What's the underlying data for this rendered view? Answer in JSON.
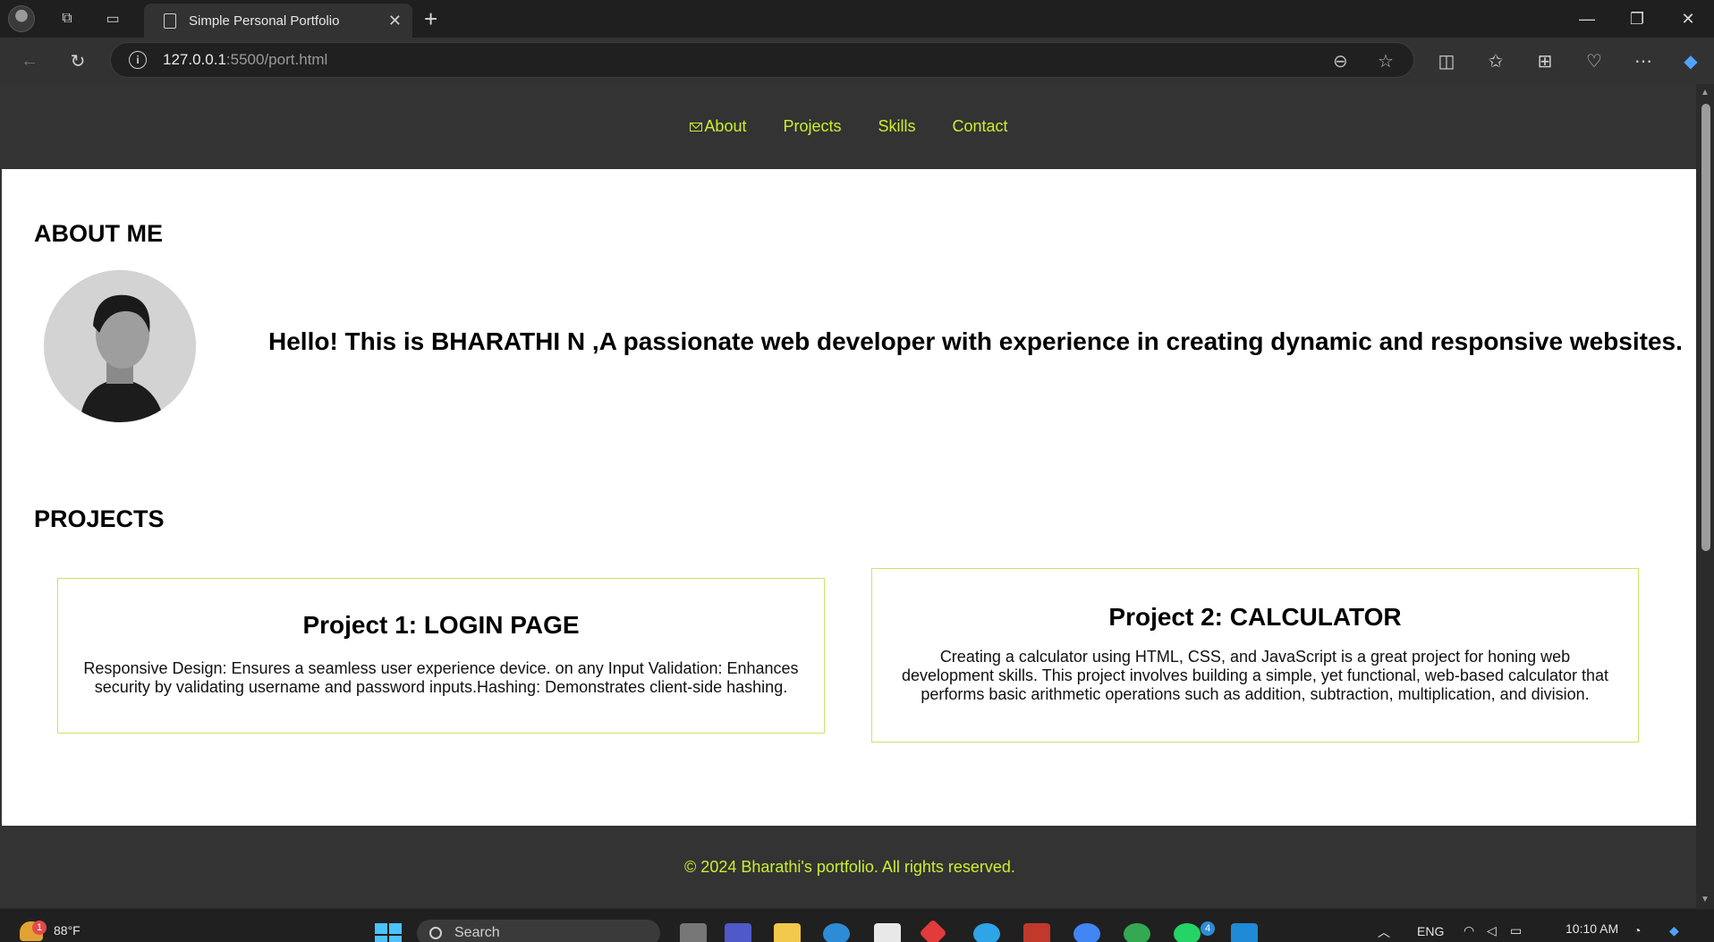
{
  "browser": {
    "tab_title": "Simple Personal Portfolio",
    "tab_close": "✕",
    "new_tab": "+",
    "url_host": "127.0.0.1",
    "url_rest": ":5500/port.html",
    "window_controls": [
      "—",
      "❐",
      "✕"
    ]
  },
  "site": {
    "nav": [
      {
        "label": "About",
        "icon": "mail-icon"
      },
      {
        "label": "Projects"
      },
      {
        "label": "Skills"
      },
      {
        "label": "Contact"
      }
    ],
    "about": {
      "title": "ABOUT ME",
      "text": "Hello! This is BHARATHI N ,A passionate web developer with experience in creating dynamic and responsive websites."
    },
    "projects": {
      "title": "PROJECTS",
      "items": [
        {
          "title": "Project 1: LOGIN PAGE",
          "description": "Responsive Design: Ensures a seamless user experience device. on any Input Validation: Enhances security by validating username and password inputs.Hashing: Demonstrates client-side hashing."
        },
        {
          "title": "Project 2: CALCULATOR",
          "description": "Creating a calculator using HTML, CSS, and JavaScript is a great project for honing web development skills. This project involves building a simple, yet functional, web-based calculator that performs basic arithmetic operations such as addition, subtraction, multiplication, and division."
        }
      ]
    },
    "footer": "© 2024 Bharathi's portfolio. All rights reserved.",
    "accent_color": "#c9f02e",
    "header_bg": "#333333"
  },
  "taskbar": {
    "weather_badge": "1",
    "temperature": "88°F",
    "search_placeholder": "Search",
    "language": "ENG",
    "time": "10:10 AM",
    "whatsapp_badge": "4"
  }
}
